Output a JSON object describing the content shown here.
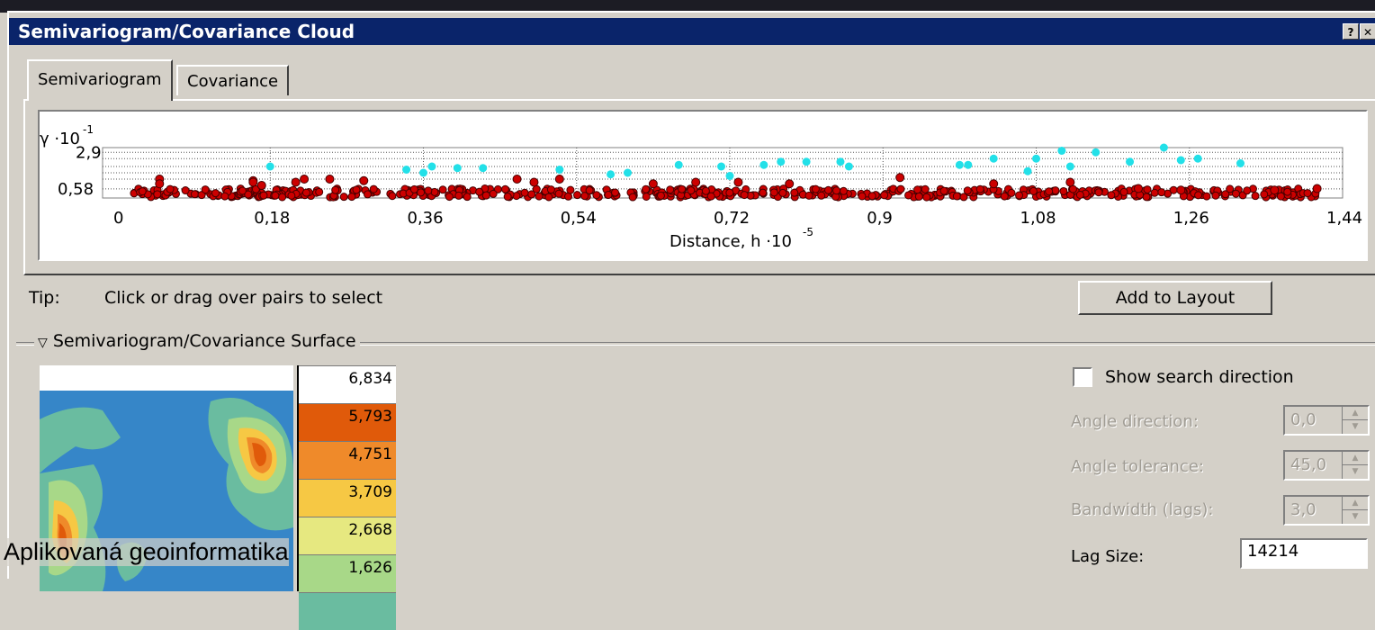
{
  "window": {
    "title": "Semivariogram/Covariance Cloud",
    "help_btn": "?",
    "close_btn": "✕"
  },
  "tabs": [
    {
      "label": "Semivariogram",
      "active": true
    },
    {
      "label": "Covariance",
      "active": false
    }
  ],
  "chart_data": {
    "type": "scatter",
    "ylabel_symbol": "γ ·10",
    "ylabel_exp": "-1",
    "xlabel": "Distance, h ·10",
    "xlabel_exp": "-5",
    "x_ticks": [
      "0",
      "0,18",
      "0,36",
      "0,54",
      "0,72",
      "0,9",
      "1,08",
      "1,26",
      "1,44"
    ],
    "y_ticks": [
      "0,58",
      "2,9"
    ],
    "xlim": [
      0,
      1.44
    ],
    "ylim": [
      0,
      3.2
    ],
    "grid": true,
    "series": [
      {
        "color": "#cc0000",
        "marker": "filled-circle-dark-outline"
      },
      {
        "color": "#22e0e8",
        "marker": "filled-circle"
      }
    ],
    "cyan_points": [
      [
        0.18,
        2.0
      ],
      [
        0.34,
        1.8
      ],
      [
        0.36,
        1.6
      ],
      [
        0.37,
        2.0
      ],
      [
        0.4,
        1.9
      ],
      [
        0.43,
        1.9
      ],
      [
        0.52,
        1.8
      ],
      [
        0.58,
        1.5
      ],
      [
        0.6,
        1.6
      ],
      [
        0.66,
        2.1
      ],
      [
        0.71,
        2.0
      ],
      [
        0.72,
        1.4
      ],
      [
        0.76,
        2.1
      ],
      [
        0.78,
        2.3
      ],
      [
        0.81,
        2.3
      ],
      [
        0.85,
        2.3
      ],
      [
        0.86,
        2.0
      ],
      [
        0.99,
        2.1
      ],
      [
        1.0,
        2.1
      ],
      [
        1.03,
        2.5
      ],
      [
        1.07,
        1.7
      ],
      [
        1.08,
        2.5
      ],
      [
        1.11,
        3.0
      ],
      [
        1.12,
        2.0
      ],
      [
        1.15,
        2.9
      ],
      [
        1.19,
        2.3
      ],
      [
        1.23,
        3.2
      ],
      [
        1.25,
        2.4
      ],
      [
        1.27,
        2.5
      ],
      [
        1.32,
        2.2
      ]
    ],
    "red_points": [
      [
        0.05,
        1.2
      ],
      [
        0.05,
        0.9
      ],
      [
        0.16,
        1.1
      ],
      [
        0.16,
        1.0
      ],
      [
        0.17,
        0.8
      ],
      [
        0.21,
        1.0
      ],
      [
        0.22,
        1.2
      ],
      [
        0.25,
        1.2
      ],
      [
        0.29,
        1.1
      ],
      [
        0.47,
        1.2
      ],
      [
        0.49,
        1.0
      ],
      [
        0.52,
        1.2
      ],
      [
        0.63,
        0.9
      ],
      [
        0.68,
        1.0
      ],
      [
        0.73,
        1.0
      ],
      [
        0.79,
        0.9
      ],
      [
        0.92,
        1.3
      ],
      [
        1.03,
        0.9
      ],
      [
        1.12,
        1.0
      ],
      [
        1.2,
        0.6
      ],
      [
        1.25,
        0.5
      ],
      [
        1.36,
        0.5
      ],
      [
        1.41,
        0.6
      ]
    ],
    "red_band": {
      "x_start": 0.02,
      "x_end": 1.42,
      "y_low": 0.05,
      "y_high": 0.6
    }
  },
  "tip": {
    "label": "Tip:",
    "text": "Click or drag over pairs to select"
  },
  "add_to_layout_label": "Add to Layout",
  "surface_group_label": "Semivariogram/Covariance Surface",
  "surface_legend": [
    "6,834",
    "5,793",
    "4,751",
    "3,709",
    "2,668",
    "1,626"
  ],
  "surface_legend_colors": [
    "#e05a0a",
    "#ef8a2a",
    "#f6c844",
    "#e6e880",
    "#a8d888",
    "#6abca0"
  ],
  "controls": {
    "show_search_direction_label": "Show search direction",
    "show_search_direction_checked": false,
    "angle_direction_label": "Angle direction:",
    "angle_direction_value": "0,0",
    "angle_tolerance_label": "Angle tolerance:",
    "angle_tolerance_value": "45,0",
    "bandwidth_label": "Bandwidth (lags):",
    "bandwidth_value": "3,0",
    "lag_size_label": "Lag Size:",
    "lag_size_value": "14214"
  },
  "watermark": "Aplikovaná geoinformatika"
}
